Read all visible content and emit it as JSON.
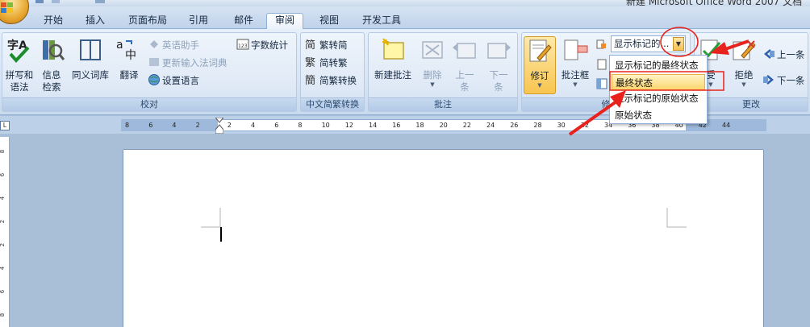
{
  "window": {
    "title": "新建 Microsoft Office Word 2007 文档",
    "office_button_icon": "office-logo-icon"
  },
  "tabs": [
    {
      "label": "开始",
      "active": false
    },
    {
      "label": "插入",
      "active": false
    },
    {
      "label": "页面布局",
      "active": false
    },
    {
      "label": "引用",
      "active": false
    },
    {
      "label": "邮件",
      "active": false
    },
    {
      "label": "审阅",
      "active": true
    },
    {
      "label": "视图",
      "active": false
    },
    {
      "label": "开发工具",
      "active": false
    }
  ],
  "groups": {
    "proofing": {
      "label": "校对",
      "spelling_label_1": "拼写和",
      "spelling_label_2": "语法",
      "research_label_1": "信息",
      "research_label_2": "检索",
      "thesaurus_label": "同义词库",
      "translate_label": "翻译",
      "english_assistant": "英语助手",
      "update_ime": "更新输入法词典",
      "set_language": "设置语言",
      "word_count": "字数统计"
    },
    "chinese_conversion": {
      "label": "中文简繁转换",
      "to_simplified": "繁转简",
      "to_traditional": "简转繁",
      "convert": "简繁转换"
    },
    "comments": {
      "label": "批注",
      "new_comment": "新建批注",
      "delete": "删除",
      "previous_1": "上一",
      "previous_2": "条",
      "next_1": "下一",
      "next_2": "条"
    },
    "tracking": {
      "label": "修",
      "track_changes": "修订",
      "balloons": "批注框",
      "display_combo_value": "显示标记的..."
    },
    "changes": {
      "label": "更改",
      "accept_partial": "受",
      "reject": "拒绝",
      "previous": "上一条",
      "next": "下一条"
    }
  },
  "dropdown": {
    "items": [
      {
        "label": "显示标记的最终状态",
        "highlighted": false
      },
      {
        "label": "最终状态",
        "highlighted": true
      },
      {
        "label": "显示标记的原始状态",
        "highlighted": false
      },
      {
        "label": "原始状态",
        "highlighted": false
      }
    ]
  },
  "ruler": {
    "corner_symbol": "L",
    "ticks": [
      "8",
      "6",
      "4",
      "2",
      "2",
      "4",
      "6",
      "8",
      "10",
      "12",
      "14",
      "16",
      "18",
      "20",
      "22",
      "24",
      "26",
      "28",
      "30",
      "32",
      "34",
      "36",
      "38",
      "40",
      "42",
      "44"
    ]
  },
  "vertical_ruler": {
    "ticks": [
      "8",
      "6",
      "4",
      "2",
      "2",
      "4",
      "6",
      "8"
    ]
  },
  "colors": {
    "annotation_red": "#e8231e",
    "ribbon_bg": "#dae6f4",
    "highlight": "#fcd66e"
  }
}
